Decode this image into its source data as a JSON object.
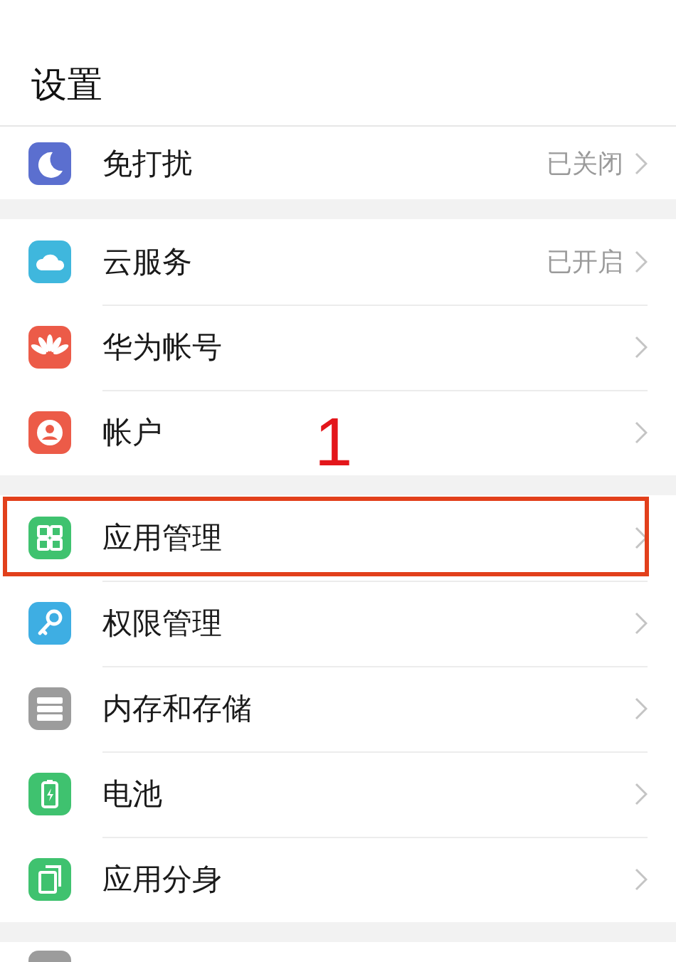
{
  "title": "设置",
  "groups": [
    {
      "items": [
        {
          "kind": "moon",
          "label": "免打扰",
          "value": "已关闭",
          "highlighted": false
        }
      ]
    },
    {
      "items": [
        {
          "kind": "cloud",
          "label": "云服务",
          "value": "已开启",
          "highlighted": false
        },
        {
          "kind": "petals",
          "label": "华为帐号",
          "highlighted": false
        },
        {
          "kind": "person",
          "label": "帐户",
          "highlighted": false
        }
      ]
    },
    {
      "items": [
        {
          "kind": "grid",
          "label": "应用管理",
          "highlighted": true
        },
        {
          "kind": "key",
          "label": "权限管理",
          "highlighted": false
        },
        {
          "kind": "storage",
          "label": "内存和存储",
          "highlighted": false
        },
        {
          "kind": "battery",
          "label": "电池",
          "highlighted": false
        },
        {
          "kind": "clone",
          "label": "应用分身",
          "highlighted": false
        }
      ]
    },
    {
      "items": [
        {
          "kind": "generic"
        }
      ]
    }
  ],
  "annotation": {
    "label": "1"
  }
}
